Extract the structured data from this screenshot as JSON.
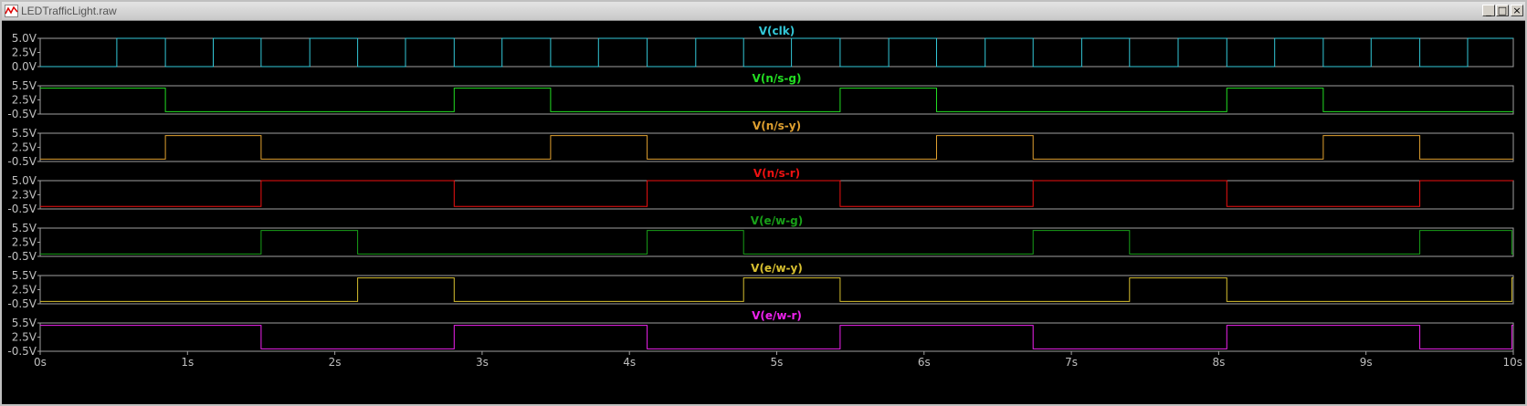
{
  "window": {
    "title": "LEDTrafficLight.raw"
  },
  "chart_data": {
    "type": "line",
    "x_unit": "s",
    "xlim": [
      0,
      10
    ],
    "x_ticks": [
      "0s",
      "1s",
      "2s",
      "3s",
      "4s",
      "5s",
      "6s",
      "7s",
      "8s",
      "9s",
      "10s"
    ],
    "panels": [
      {
        "name": "V(clk)",
        "color": "#33c8d8",
        "ylim": [
          0.0,
          5.0
        ],
        "y_ticks": [
          "5.0V",
          "2.5V",
          "0.0V"
        ],
        "x": [
          0,
          0.52,
          0.52,
          0.85,
          0.85,
          1.175,
          1.175,
          1.5,
          1.5,
          1.83,
          1.83,
          2.155,
          2.155,
          2.48,
          2.48,
          2.81,
          2.81,
          3.135,
          3.135,
          3.465,
          3.465,
          3.79,
          3.79,
          4.12,
          4.12,
          4.45,
          4.45,
          4.775,
          4.775,
          5.1,
          5.1,
          5.43,
          5.43,
          5.76,
          5.76,
          6.085,
          6.085,
          6.415,
          6.415,
          6.74,
          6.74,
          7.07,
          7.07,
          7.395,
          7.395,
          7.725,
          7.725,
          8.055,
          8.055,
          8.38,
          8.38,
          8.71,
          8.71,
          9.035,
          9.035,
          9.365,
          9.365,
          9.69,
          9.69,
          10
        ],
        "y": [
          0,
          0,
          5,
          5,
          0,
          0,
          5,
          5,
          0,
          0,
          5,
          5,
          0,
          0,
          5,
          5,
          0,
          0,
          5,
          5,
          0,
          0,
          5,
          5,
          0,
          0,
          5,
          5,
          0,
          0,
          5,
          5,
          0,
          0,
          5,
          5,
          0,
          0,
          5,
          5,
          0,
          0,
          5,
          5,
          0,
          0,
          5,
          5,
          0,
          0,
          5,
          5,
          0,
          0,
          5,
          5,
          0,
          0,
          5,
          5
        ]
      },
      {
        "name": "V(n/s-g)",
        "color": "#22dd22",
        "ylim": [
          -0.5,
          5.5
        ],
        "y_ticks": [
          "5.5V",
          "2.5V",
          "-0.5V"
        ],
        "x": [
          0,
          0.85,
          0.85,
          2.81,
          2.81,
          3.465,
          3.465,
          5.43,
          5.43,
          6.085,
          6.085,
          8.055,
          8.055,
          8.71,
          8.71,
          10
        ],
        "y": [
          5,
          5,
          0,
          0,
          5,
          5,
          0,
          0,
          5,
          5,
          0,
          0,
          5,
          5,
          0,
          0
        ]
      },
      {
        "name": "V(n/s-y)",
        "color": "#e0a030",
        "ylim": [
          -0.5,
          5.5
        ],
        "y_ticks": [
          "5.5V",
          "2.5V",
          "-0.5V"
        ],
        "x": [
          0,
          0.85,
          0.85,
          1.5,
          1.5,
          3.465,
          3.465,
          4.12,
          4.12,
          6.085,
          6.085,
          6.74,
          6.74,
          8.71,
          8.71,
          9.365,
          9.365,
          10
        ],
        "y": [
          0,
          0,
          5,
          5,
          0,
          0,
          5,
          5,
          0,
          0,
          5,
          5,
          0,
          0,
          5,
          5,
          0,
          0
        ]
      },
      {
        "name": "V(n/s-r)",
        "color": "#ee1111",
        "ylim": [
          -0.5,
          5.0
        ],
        "y_ticks": [
          "5.0V",
          "2.3V",
          "-0.5V"
        ],
        "x": [
          0,
          1.5,
          1.5,
          2.81,
          2.81,
          4.12,
          4.12,
          5.43,
          5.43,
          6.74,
          6.74,
          8.055,
          8.055,
          9.365,
          9.365,
          10
        ],
        "y": [
          0,
          0,
          5,
          5,
          0,
          0,
          5,
          5,
          0,
          0,
          5,
          5,
          0,
          0,
          5,
          5
        ]
      },
      {
        "name": "V(e/w-g)",
        "color": "#18a018",
        "ylim": [
          -0.5,
          5.5
        ],
        "y_ticks": [
          "5.5V",
          "2.5V",
          "-0.5V"
        ],
        "x": [
          0,
          1.5,
          1.5,
          2.155,
          2.155,
          4.12,
          4.12,
          4.775,
          4.775,
          6.74,
          6.74,
          7.395,
          7.395,
          9.365,
          9.365,
          9.99,
          9.99,
          10
        ],
        "y": [
          0,
          0,
          5,
          5,
          0,
          0,
          5,
          5,
          0,
          0,
          5,
          5,
          0,
          0,
          5,
          5,
          0,
          0
        ]
      },
      {
        "name": "V(e/w-y)",
        "color": "#d8c030",
        "ylim": [
          -0.5,
          5.5
        ],
        "y_ticks": [
          "5.5V",
          "2.5V",
          "-0.5V"
        ],
        "x": [
          0,
          2.155,
          2.155,
          2.81,
          2.81,
          4.775,
          4.775,
          5.43,
          5.43,
          7.395,
          7.395,
          8.055,
          8.055,
          9.99,
          9.99,
          10
        ],
        "y": [
          0,
          0,
          5,
          5,
          0,
          0,
          5,
          5,
          0,
          0,
          5,
          5,
          0,
          0,
          5,
          5
        ]
      },
      {
        "name": "V(e/w-r)",
        "color": "#ee22ee",
        "ylim": [
          -0.5,
          5.5
        ],
        "y_ticks": [
          "5.5V",
          "2.5V",
          "-0.5V"
        ],
        "x": [
          0,
          1.5,
          1.5,
          2.81,
          2.81,
          4.12,
          4.12,
          5.43,
          5.43,
          6.74,
          6.74,
          8.055,
          8.055,
          9.365,
          9.365,
          9.99,
          9.99,
          10
        ],
        "y": [
          5,
          5,
          0,
          0,
          5,
          5,
          0,
          0,
          5,
          5,
          0,
          0,
          5,
          5,
          0,
          0,
          5,
          5
        ]
      }
    ]
  }
}
